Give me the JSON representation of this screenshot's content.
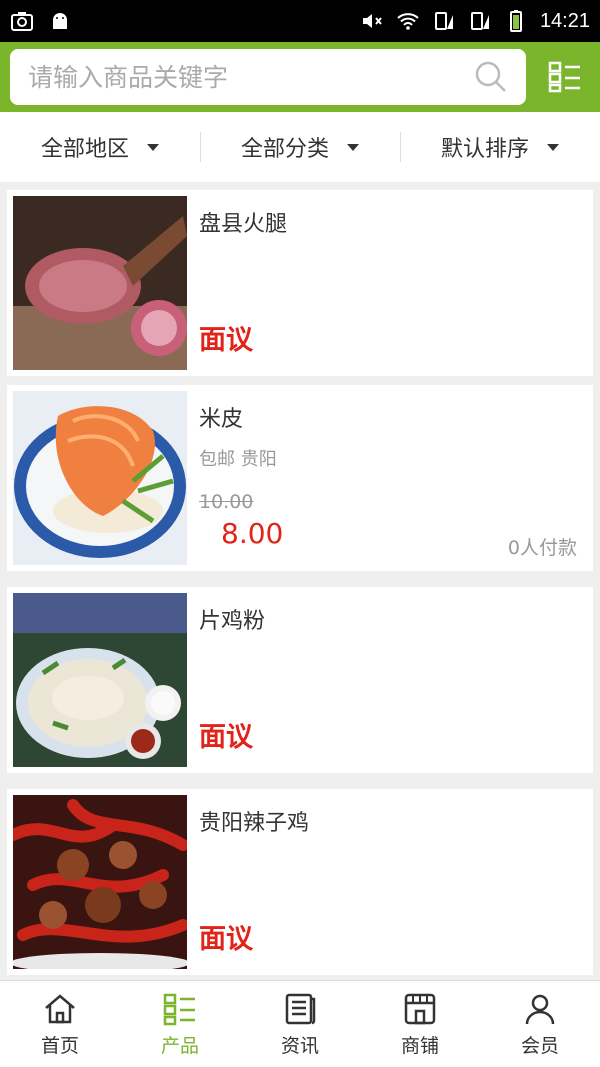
{
  "status_bar": {
    "time": "14:21"
  },
  "search": {
    "placeholder": "请输入商品关键字"
  },
  "filters": [
    {
      "label": "全部地区"
    },
    {
      "label": "全部分类"
    },
    {
      "label": "默认排序"
    }
  ],
  "products": [
    {
      "title": "盘县火腿",
      "price_text": "面议",
      "image": "ham"
    },
    {
      "title": "米皮",
      "subtitle": "包邮 贵阳",
      "old_price": "10.00",
      "price": "8.00",
      "sold": "0人付款",
      "image": "rice-noodle"
    },
    {
      "title": "片鸡粉",
      "price_text": "面议",
      "image": "chicken-noodle"
    },
    {
      "title": "贵阳辣子鸡",
      "price_text": "面议",
      "image": "spicy-chicken"
    }
  ],
  "nav": [
    {
      "label": "首页",
      "icon": "home-icon"
    },
    {
      "label": "产品",
      "icon": "products-icon"
    },
    {
      "label": "资讯",
      "icon": "news-icon"
    },
    {
      "label": "商铺",
      "icon": "shop-icon"
    },
    {
      "label": "会员",
      "icon": "member-icon"
    }
  ],
  "colors": {
    "accent": "#7bb52c",
    "price": "#e2231a"
  }
}
